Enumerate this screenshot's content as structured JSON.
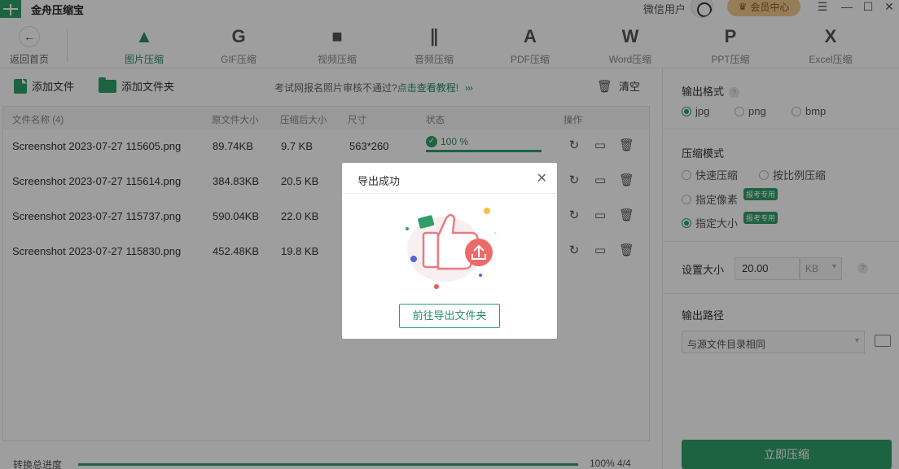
{
  "app": {
    "title": "金舟压缩宝",
    "user": "微信用户",
    "vip": "会员中心"
  },
  "window_controls": [
    "☰",
    "—",
    "☐",
    "✕"
  ],
  "toolbar": {
    "back": "返回首页",
    "tools": [
      {
        "label": "图片压缩",
        "icon": "image-compress-icon",
        "glyph": "▲"
      },
      {
        "label": "GIF压缩",
        "icon": "gif-compress-icon",
        "glyph": "G"
      },
      {
        "label": "视频压缩",
        "icon": "video-compress-icon",
        "glyph": "■"
      },
      {
        "label": "音频压缩",
        "icon": "audio-compress-icon",
        "glyph": "∥"
      },
      {
        "label": "PDF压缩",
        "icon": "pdf-compress-icon",
        "glyph": "A"
      },
      {
        "label": "Word压缩",
        "icon": "word-compress-icon",
        "glyph": "W"
      },
      {
        "label": "PPT压缩",
        "icon": "ppt-compress-icon",
        "glyph": "P"
      },
      {
        "label": "Excel压缩",
        "icon": "excel-compress-icon",
        "glyph": "X"
      }
    ]
  },
  "actions": {
    "add_file": "添加文件",
    "add_folder": "添加文件夹",
    "notice_text": "考试网报名照片审核不通过?",
    "notice_link": "点击查看教程!",
    "notice_arrows": "›››",
    "clear": "清空"
  },
  "table": {
    "headers": {
      "name": "文件名称 (4)",
      "orig": "原文件大小",
      "compressed": "压缩后大小",
      "dims": "尺寸",
      "status": "状态",
      "ops": "操作"
    },
    "rows": [
      {
        "name": "Screenshot 2023-07-27 115605.png",
        "orig": "89.74KB",
        "compressed": "9.7 KB",
        "dims": "563*260",
        "status": "100 %",
        "progress": 1.0
      },
      {
        "name": "Screenshot 2023-07-27 115614.png",
        "orig": "384.83KB",
        "compressed": "20.5 KB"
      },
      {
        "name": "Screenshot 2023-07-27 115737.png",
        "orig": "590.04KB",
        "compressed": "22.0 KB"
      },
      {
        "name": "Screenshot 2023-07-27 115830.png",
        "orig": "452.48KB",
        "compressed": "19.8 KB"
      }
    ]
  },
  "bottom": {
    "label": "转换总进度",
    "percent": "100% 4/4",
    "progress": 1.0
  },
  "panel": {
    "output_format": {
      "title": "输出格式",
      "options": [
        "jpg",
        "png",
        "bmp"
      ],
      "selected": "jpg"
    },
    "mode": {
      "title": "压缩模式",
      "options": [
        "快速压缩",
        "按比例压缩",
        "指定像素",
        "指定大小"
      ],
      "tag": "报考专用",
      "selected": "指定大小"
    },
    "size": {
      "title": "设置大小",
      "value": "20.00",
      "unit": "KB"
    },
    "path": {
      "title": "输出路径",
      "value": "与源文件目录相同"
    },
    "start": "立即压缩"
  },
  "modal": {
    "title": "导出成功",
    "button": "前往导出文件夹"
  },
  "colors": {
    "accent": "#2f9e6a",
    "vip": "#f3c98d"
  }
}
